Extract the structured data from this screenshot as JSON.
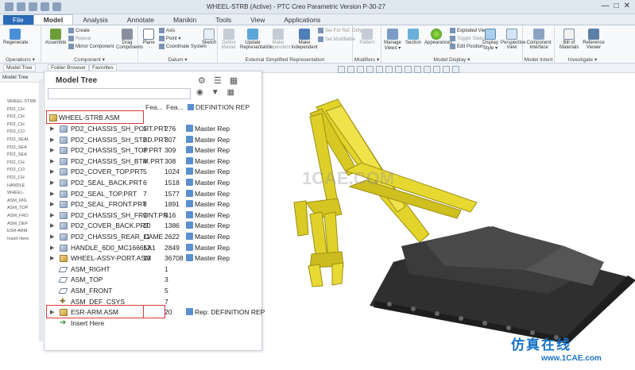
{
  "window": {
    "title": "WHEEL-STRB (Active) - PTC Creo Parametric Version P-30-27"
  },
  "tabs": [
    "File",
    "Model",
    "Analysis",
    "Annotate",
    "Manikin",
    "Tools",
    "View",
    "Applications"
  ],
  "ribbon": {
    "groups": [
      {
        "label": "Operations ▾",
        "buttons": [
          "Regenerate"
        ]
      },
      {
        "label": "Component ▾",
        "buttons": [
          "Assemble",
          "Create",
          "Repeat",
          "Mirror Component",
          "Drag Components"
        ]
      },
      {
        "label": "Datum ▾",
        "buttons": [
          "Plane",
          "Axis",
          "Point ▾",
          "Coordinate System",
          "Sketch"
        ]
      },
      {
        "label": "External Simplified Representation",
        "buttons": [
          "Define Master",
          "Update Representation",
          "Make Dependent",
          "Make Independent",
          "Set For Ref. Only",
          "Set Modifiable"
        ]
      },
      {
        "label": "Modifiers ▾",
        "buttons": [
          "Pattern"
        ]
      },
      {
        "label": "Model Display ▾",
        "buttons": [
          "Manage Views ▾",
          "Section",
          "Appearances",
          "Exploded View",
          "Toggle Status",
          "Edit Position",
          "Display Style ▾",
          "Perspective View"
        ]
      },
      {
        "label": "Model Intent",
        "buttons": [
          "Component Interface"
        ]
      },
      {
        "label": "Investigate ▾",
        "buttons": [
          "Bill of Materials",
          "Reference Viewer"
        ]
      }
    ]
  },
  "subbar": {
    "tabs": [
      "Model Tree",
      "Folder Browser",
      "Favorites"
    ]
  },
  "left_panel": {
    "header": "Model Tree",
    "items": [
      "WHEEL-STRB",
      "PD2_CH",
      "PD2_CH",
      "PD2_CH",
      "PD2_CO",
      "PD2_SEAL",
      "PD2_SEA",
      "PD2_SEA",
      "PD2_CH",
      "PD2_CO",
      "PD2_CH",
      "HANDLE",
      "WHEEL-",
      "ASM_RIG",
      "ASM_TOP",
      "ASM_FRO",
      "ASM_DEF",
      "ESR-ARM",
      "Insert Here"
    ]
  },
  "model_tree": {
    "title": "Model Tree",
    "search_placeholder": "",
    "columns": [
      "Fea...",
      "Fea...",
      "DEFINITION REP"
    ],
    "root": "WHEEL-STRB.ASM",
    "rows": [
      {
        "name": "PD2_CHASSIS_SH_PORT.PRT",
        "f1": "1",
        "f2": "276",
        "rep": "Master Rep",
        "type": "part"
      },
      {
        "name": "PD2_CHASSIS_SH_STBD.PRT",
        "f1": "2",
        "f2": "307",
        "rep": "Master Rep",
        "type": "part"
      },
      {
        "name": "PD2_CHASSIS_SH_TOP.PRT",
        "f1": "3",
        "f2": "309",
        "rep": "Master Rep",
        "type": "part"
      },
      {
        "name": "PD2_CHASSIS_SH_BTM.PRT",
        "f1": "4",
        "f2": "308",
        "rep": "Master Rep",
        "type": "part"
      },
      {
        "name": "PD2_COVER_TOP.PRT",
        "f1": "5",
        "f2": "1024",
        "rep": "Master Rep",
        "type": "part"
      },
      {
        "name": "PD2_SEAL_BACK.PRT",
        "f1": "6",
        "f2": "1518",
        "rep": "Master Rep",
        "type": "part"
      },
      {
        "name": "PD2_SEAL_TOP.PRT",
        "f1": "7",
        "f2": "1577",
        "rep": "Master Rep",
        "type": "part"
      },
      {
        "name": "PD2_SEAL_FRONT.PRT",
        "f1": "8",
        "f2": "1891",
        "rep": "Master Rep",
        "type": "part"
      },
      {
        "name": "PD2_CHASSIS_SH_FRONT.PRT",
        "f1": "9",
        "f2": "516",
        "rep": "Master Rep",
        "type": "part"
      },
      {
        "name": "PD2_COVER_BACK.PRT",
        "f1": "10",
        "f2": "1386",
        "rep": "Master Rep",
        "type": "part"
      },
      {
        "name": "PD2_CHASSIS_REAR_CAME",
        "f1": "11",
        "f2": "2622",
        "rep": "Master Rep",
        "type": "part"
      },
      {
        "name": "HANDLE_6D0_MC16665A1",
        "f1": "12",
        "f2": "2849",
        "rep": "Master Rep",
        "type": "part"
      },
      {
        "name": "WHEEL-ASSY-PORT.ASM",
        "f1": "13",
        "f2": "36708",
        "rep": "Master Rep",
        "type": "asm"
      },
      {
        "name": "ASM_RIGHT",
        "f1": "",
        "f2": "1",
        "rep": "",
        "type": "plane"
      },
      {
        "name": "ASM_TOP",
        "f1": "",
        "f2": "3",
        "rep": "",
        "type": "plane"
      },
      {
        "name": "ASM_FRONT",
        "f1": "",
        "f2": "5",
        "rep": "",
        "type": "plane"
      },
      {
        "name": "ASM_DEF_CSYS",
        "f1": "",
        "f2": "7",
        "rep": "",
        "type": "csys"
      },
      {
        "name": "ESR-ARM.ASM",
        "f1": "",
        "f2": "20",
        "rep": "Rep: DEFINITION REP",
        "type": "asm"
      },
      {
        "name": "Insert Here",
        "f1": "",
        "f2": "",
        "rep": "",
        "type": "insert"
      }
    ],
    "rows_f1_alt": [
      "2",
      "3",
      "4",
      "5",
      "6"
    ]
  },
  "viewport": {
    "watermark": "1CAE.COM"
  },
  "brand": {
    "cn_text": "仿真在线",
    "url": "www.1CAE.com"
  },
  "colors": {
    "accent": "#2a6ab8",
    "highlight": "#d73a3a",
    "robot_yellow": "#e6d62a",
    "robot_dark": "#2a2a2a"
  }
}
